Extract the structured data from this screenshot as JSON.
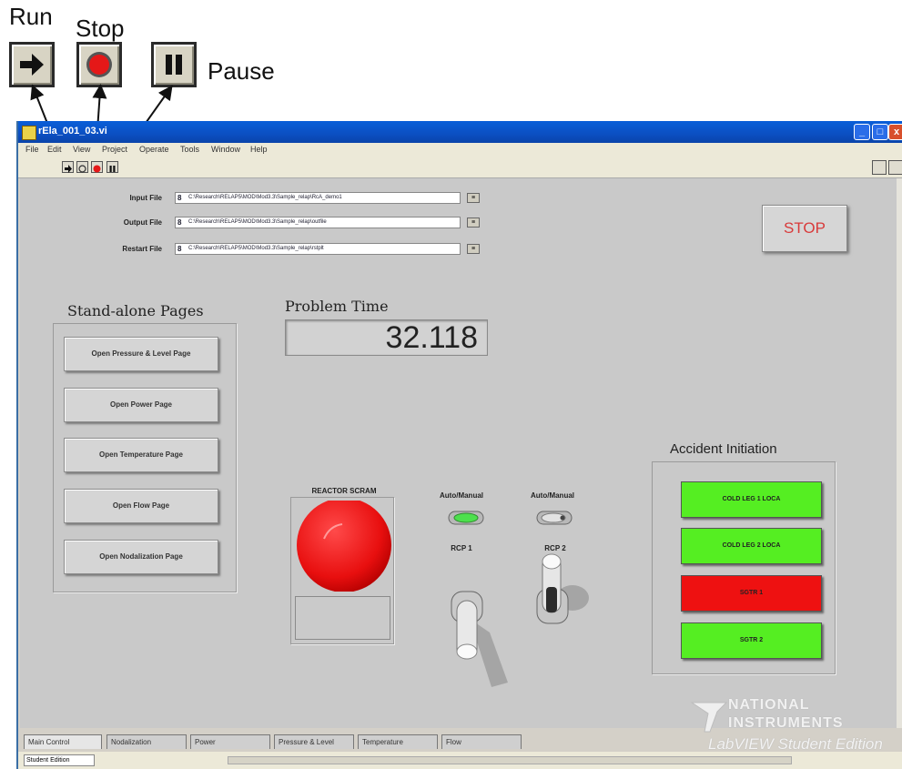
{
  "callouts": {
    "run_label": "Run",
    "stop_label": "Stop",
    "pause_label": "Pause"
  },
  "window": {
    "title": "rEla_001_03.vi",
    "menu": [
      "File",
      "Edit",
      "View",
      "Project",
      "Operate",
      "Tools",
      "Window",
      "Help"
    ]
  },
  "files": [
    {
      "label": "Input File",
      "prefix": "8",
      "path": "C:\\Research\\RELAP5\\MOD\\Mod3.3\\Sample_relap\\RcA_demo1"
    },
    {
      "label": "Output File",
      "prefix": "8",
      "path": "C:\\Research\\RELAP5\\MOD\\Mod3.3\\Sample_relap\\outfile"
    },
    {
      "label": "Restart File",
      "prefix": "8",
      "path": "C:\\Research\\RELAP5\\MOD\\Mod3.3\\Sample_relap\\rstplt"
    }
  ],
  "stop_button": "STOP",
  "standalone": {
    "heading": "Stand-alone Pages",
    "buttons": [
      "Open Pressure & Level Page",
      "Open Power Page",
      "Open Temperature Page",
      "Open Flow Page",
      "Open Nodalization Page"
    ]
  },
  "problem_time": {
    "label": "Problem Time",
    "value": "32.118"
  },
  "reactor_scram": "REACTOR SCRAM",
  "rcp": [
    {
      "mode_label": "Auto/Manual",
      "name": "RCP 1",
      "led": "green"
    },
    {
      "mode_label": "Auto/Manual",
      "name": "RCP 2",
      "led": "grey"
    }
  ],
  "accident": {
    "heading": "Accident Initiation",
    "buttons": [
      {
        "label": "COLD LEG 1 LOCA",
        "color": "#55ee22"
      },
      {
        "label": "COLD LEG 2 LOCA",
        "color": "#55ee22"
      },
      {
        "label": "SGTR 1",
        "color": "#ee1111"
      },
      {
        "label": "SGTR 2",
        "color": "#55ee22"
      }
    ]
  },
  "tabs": [
    "Main Control",
    "Nodalization",
    "Power",
    "Pressure & Level",
    "Temperature",
    "Flow"
  ],
  "status": "Student Edition",
  "watermark": {
    "line1": "NATIONAL",
    "line2": "INSTRUMENTS",
    "line3": "LabVIEW Student Edition"
  }
}
